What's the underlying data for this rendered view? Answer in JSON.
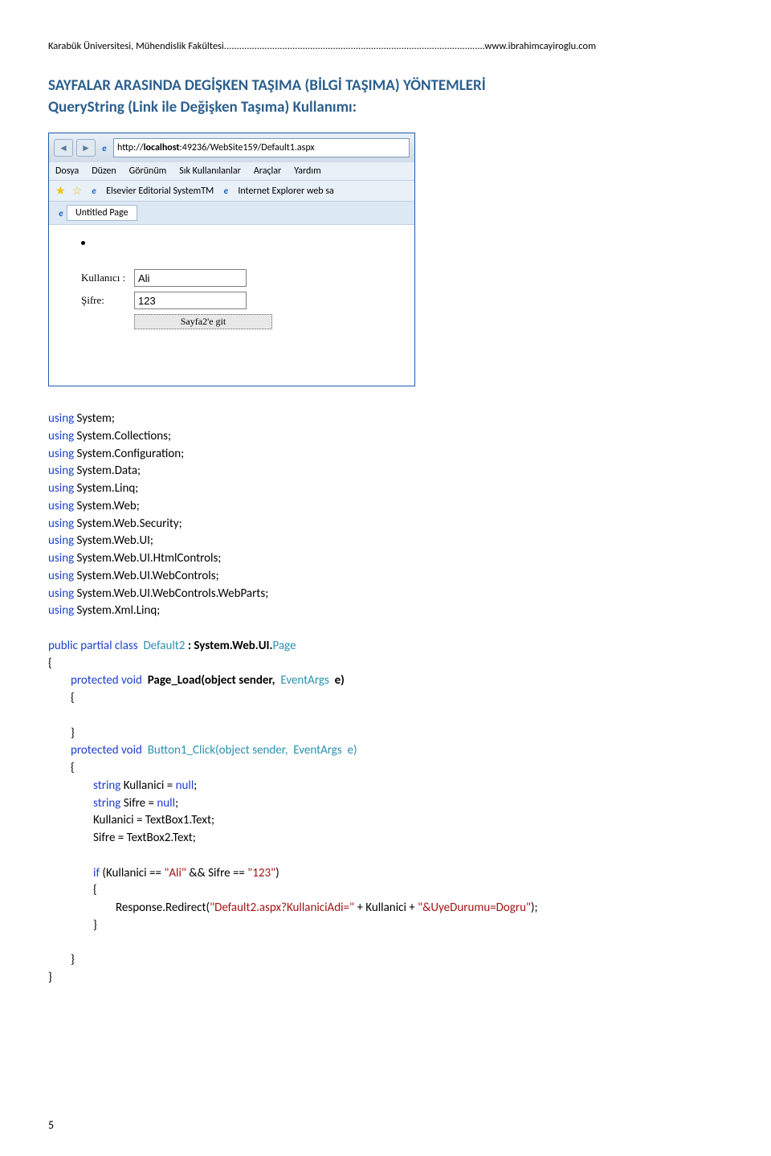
{
  "header": "Karabük Üniversitesi, Mühendislik Fakültesi.......................................................................................................www.ibrahimcayiroglu.com",
  "title": "SAYFALAR ARASINDA DEGİŞKEN TAŞIMA (BİLGİ TAŞIMA) YÖNTEMLERİ",
  "subtitle": "QueryString (Link ile Değişken Taşıma) Kullanımı:",
  "browser": {
    "url_prefix": "http://",
    "url_host": "localhost",
    "url_rest": ":49236/WebSite159/Default1.aspx",
    "menu": [
      "Dosya",
      "Düzen",
      "Görünüm",
      "Sık Kullanılanlar",
      "Araçlar",
      "Yardım"
    ],
    "favorites": [
      "Elsevier Editorial SystemTM",
      "Internet Explorer web sa"
    ],
    "tab_title": "Untitled Page",
    "form": {
      "user_label": "Kullanıcı :",
      "user_value": "Ali",
      "pass_label": "Şifre:",
      "pass_value": "123",
      "button_label": "Sayfa2'e git"
    }
  },
  "code": {
    "usings": [
      "System",
      "System.Collections",
      "System.Configuration",
      "System.Data",
      "System.Linq",
      "System.Web",
      "System.Web.Security",
      "System.Web.UI",
      "System.Web.UI.HtmlControls",
      "System.Web.UI.WebControls",
      "System.Web.UI.WebControls.WebParts",
      "System.Xml.Linq"
    ],
    "class_decl_public": "public partial class",
    "class_name": "Default2",
    "class_inherits": ": System.Web.UI.",
    "class_page": "Page",
    "pl_protected": "protected void",
    "pl_signature": "Page_Load(object sender,",
    "pl_eventargs": "EventArgs",
    "pl_e": "e)",
    "btn_protected": "protected void",
    "btn_signature": "Button1_Click(object sender,",
    "btn_eventargs": "EventArgs",
    "btn_e": "e)",
    "line_kullanici_decl_kw": "string",
    "line_kullanici_decl_rest": " Kullanici = ",
    "line_kullanici_decl_null": "null",
    "line_sifre_decl_kw": "string",
    "line_sifre_decl_rest": " Sifre = ",
    "line_sifre_decl_null": "null",
    "line_kullanici_assign": "Kullanici = TextBox1.Text;",
    "line_sifre_assign": "Sifre = TextBox2.Text;",
    "if_kw": "if",
    "if_open": " (Kullanici == ",
    "if_str1": "\"Ali\"",
    "if_mid": " && Sifre == ",
    "if_str2": "\"123\"",
    "if_close": ")",
    "redirect_call": "Response.Redirect(",
    "redirect_str1": "\"Default2.aspx?KullaniciAdi=\"",
    "redirect_mid1": " + Kullanici + ",
    "redirect_str2": "\"&UyeDurumu=Dogru\"",
    "redirect_end": ");",
    "using_kw": "using",
    "semicolon": ";"
  },
  "page_number": "5"
}
